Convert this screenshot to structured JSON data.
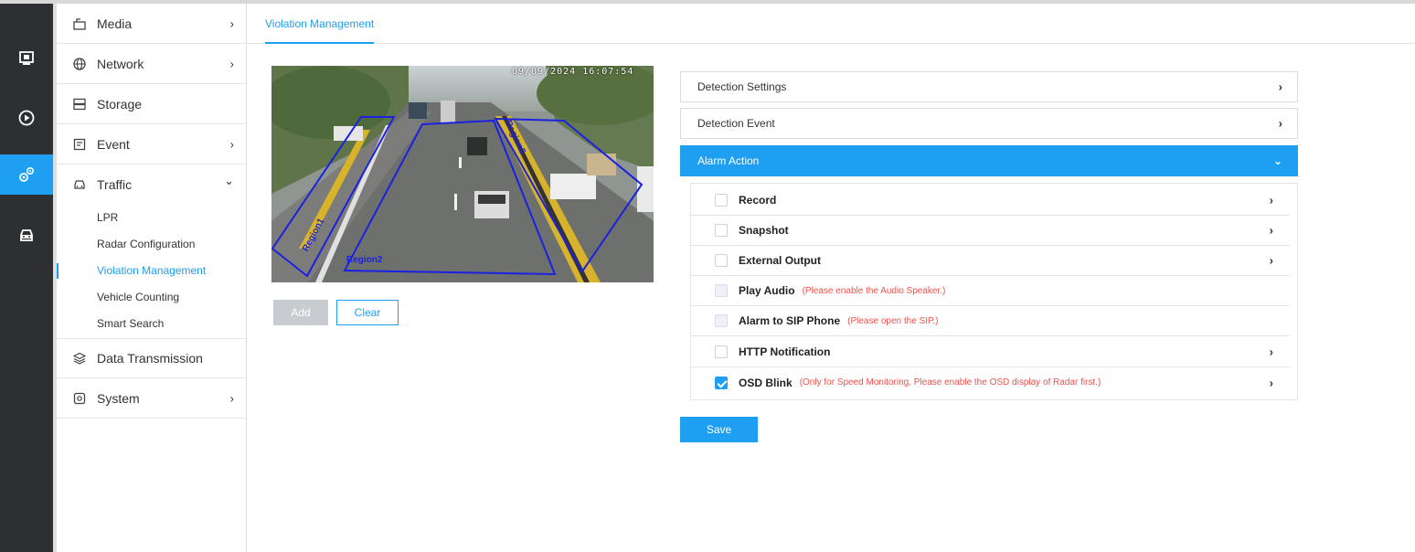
{
  "rail": {
    "items": [
      {
        "icon": "live-view-icon",
        "active": false
      },
      {
        "icon": "playback-icon",
        "active": false
      },
      {
        "icon": "settings-gears-icon",
        "active": true
      },
      {
        "icon": "vehicle-icon",
        "active": false
      }
    ]
  },
  "menu": {
    "items": [
      {
        "label": "Media",
        "icon": "media-icon",
        "chevron": "›"
      },
      {
        "label": "Network",
        "icon": "globe-icon",
        "chevron": "›"
      },
      {
        "label": "Storage",
        "icon": "storage-icon",
        "chevron": ""
      },
      {
        "label": "Event",
        "icon": "event-icon",
        "chevron": "›"
      },
      {
        "label": "Traffic",
        "icon": "car-icon",
        "chevron": "⌄"
      }
    ],
    "traffic_sub": [
      {
        "label": "LPR",
        "active": false
      },
      {
        "label": "Radar Configuration",
        "active": false
      },
      {
        "label": "Violation Management",
        "active": true
      },
      {
        "label": "Vehicle Counting",
        "active": false
      },
      {
        "label": "Smart Search",
        "active": false
      }
    ],
    "bottom_items": [
      {
        "label": "Data Transmission",
        "icon": "layers-icon",
        "chevron": ""
      },
      {
        "label": "System",
        "icon": "system-icon",
        "chevron": "›"
      }
    ]
  },
  "tab": {
    "label": "Violation Management"
  },
  "video": {
    "timestamp": "09/09/2024 16:07:54",
    "regions": [
      "Region1",
      "Region2",
      "Region3"
    ]
  },
  "buttons": {
    "add": "Add",
    "clear": "Clear",
    "save": "Save"
  },
  "panels": {
    "detection_settings": "Detection Settings",
    "detection_event": "Detection Event",
    "alarm_action": "Alarm Action"
  },
  "alarm_actions": [
    {
      "label": "Record",
      "note": "",
      "checked": false,
      "disabled": false,
      "chevron": "›"
    },
    {
      "label": "Snapshot",
      "note": "",
      "checked": false,
      "disabled": false,
      "chevron": "›"
    },
    {
      "label": "External Output",
      "note": "",
      "checked": false,
      "disabled": false,
      "chevron": "›"
    },
    {
      "label": "Play Audio",
      "note": "(Please enable the Audio Speaker.)",
      "checked": false,
      "disabled": true,
      "chevron": ""
    },
    {
      "label": "Alarm to SIP Phone",
      "note": "(Please open the SIP.)",
      "checked": false,
      "disabled": true,
      "chevron": ""
    },
    {
      "label": "HTTP Notification",
      "note": "",
      "checked": false,
      "disabled": false,
      "chevron": "›"
    },
    {
      "label": "OSD Blink",
      "note": "(Only for Speed Monitoring, Please enable the OSD display of Radar first.)",
      "checked": true,
      "disabled": false,
      "chevron": "›"
    }
  ],
  "colors": {
    "accent": "#1e9ff2",
    "warning": "#f0504a",
    "rail": "#2d2f33"
  }
}
